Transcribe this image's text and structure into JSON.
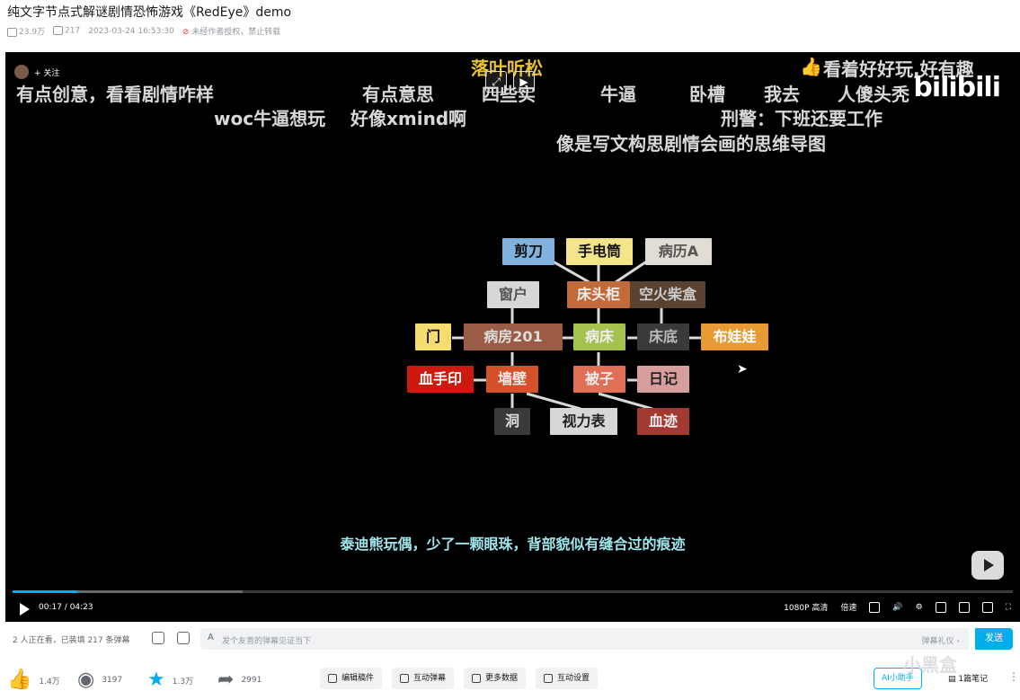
{
  "video": {
    "title": "纯文字节点式解谜剧情恐怖游戏《RedEye》demo",
    "views": "23.9万",
    "danmaku_count": "217",
    "date": "2023-03-24 16:53:30",
    "copyright": "未经作者授权，禁止转载"
  },
  "player": {
    "follow": "+ 关注",
    "logo": "bilibili",
    "danmaku": [
      {
        "text": "落叶听松",
        "color": "yellow"
      },
      {
        "text": "看着好好玩,好有趣",
        "color": "white"
      },
      {
        "text": "有点创意，看看剧情咋样",
        "color": "white"
      },
      {
        "text": "有点意思",
        "color": "white"
      },
      {
        "text": "四些实",
        "color": "white"
      },
      {
        "text": "牛逼",
        "color": "white"
      },
      {
        "text": "卧槽",
        "color": "white"
      },
      {
        "text": "我去",
        "color": "white"
      },
      {
        "text": "人傻头秃",
        "color": "white"
      },
      {
        "text": "woc牛逼想玩",
        "color": "white"
      },
      {
        "text": "好像xmind啊",
        "color": "white"
      },
      {
        "text": "刑警：下班还要工作",
        "color": "white"
      },
      {
        "text": "像是写文构思剧情会画的思维导图",
        "color": "white"
      }
    ],
    "graph_nodes": [
      {
        "label": "剪刀",
        "bg": "#7fb3dd",
        "fg": "#111"
      },
      {
        "label": "手电筒",
        "bg": "#f5e58a",
        "fg": "#111"
      },
      {
        "label": "病历A",
        "bg": "#e2ddd2",
        "fg": "#555"
      },
      {
        "label": "窗户",
        "bg": "#d7d7d7",
        "fg": "#555"
      },
      {
        "label": "床头柜",
        "bg": "#c26a3a",
        "fg": "#eee"
      },
      {
        "label": "空火柴盒",
        "bg": "#5a4232",
        "fg": "#ccc"
      },
      {
        "label": "门",
        "bg": "#f6dd6f",
        "fg": "#111"
      },
      {
        "label": "病房201",
        "bg": "#9a5c44",
        "fg": "#ddd"
      },
      {
        "label": "病床",
        "bg": "#a6c24e",
        "fg": "#eee"
      },
      {
        "label": "床底",
        "bg": "#3a3a3a",
        "fg": "#bbb"
      },
      {
        "label": "布娃娃",
        "bg": "#e89a35",
        "fg": "#fff"
      },
      {
        "label": "血手印",
        "bg": "#cc1a0e",
        "fg": "#fff"
      },
      {
        "label": "墙壁",
        "bg": "#d4512a",
        "fg": "#eee"
      },
      {
        "label": "被子",
        "bg": "#e07055",
        "fg": "#eee"
      },
      {
        "label": "日记",
        "bg": "#d69f9d",
        "fg": "#222"
      },
      {
        "label": "洞",
        "bg": "#3a3a3a",
        "fg": "#ddd"
      },
      {
        "label": "视力表",
        "bg": "#d7d7d7",
        "fg": "#222"
      },
      {
        "label": "血迹",
        "bg": "#a33a32",
        "fg": "#eee"
      }
    ],
    "subtitle": "泰迪熊玩偶，少了一颗眼珠，背部貌似有缝合过的痕迹",
    "progress": {
      "played_fraction": 0.065,
      "buffered_fraction": 0.23
    },
    "time": "00:17 / 04:23",
    "quality": "1080P 高清",
    "speed": "倍速"
  },
  "danmaku_bar": {
    "viewers": "2 人正在看，已装填 217 条弹幕",
    "placeholder": "发个友善的弹幕见证当下",
    "etiquette": "弹幕礼仪 ›",
    "send": "发送"
  },
  "actions": {
    "like": "1.4万",
    "coin": "3197",
    "favorite": "1.3万",
    "share": "2991",
    "edit": "编辑稿件",
    "interactive_dm": "互动弹幕",
    "more_data": "更多数据",
    "interactive_settings": "互动设置",
    "ai_helper": "AI小助手",
    "notes": "1篇笔记",
    "more": "⋮",
    "watermark": "小黑盒"
  },
  "colors": {
    "accent": "#00aeec",
    "bg_player": "#000000"
  }
}
